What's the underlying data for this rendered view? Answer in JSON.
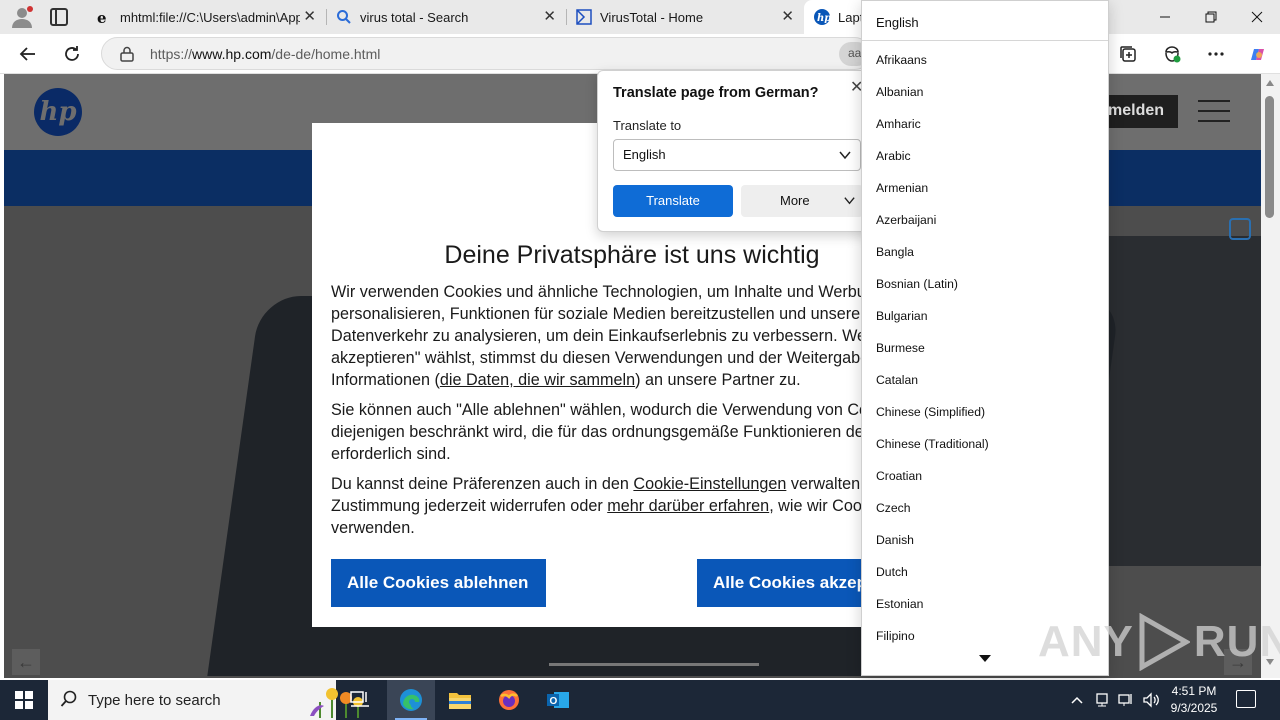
{
  "browser": {
    "tabs": [
      {
        "title": "mhtml:file://C:\\Users\\admin\\AppD",
        "close": "✕"
      },
      {
        "title": "virus total - Search",
        "close": "✕"
      },
      {
        "title": "VirusTotal - Home",
        "close": "✕"
      },
      {
        "title": "Lapt",
        "close": ""
      }
    ],
    "address": {
      "url_prefix": "https://",
      "url_domain": "www.hp.com",
      "url_path": "/de-de/home.html",
      "translate_chip": "aa"
    }
  },
  "page": {
    "hp_login_label": "melden",
    "hp_logo_text": "hp"
  },
  "cookie_dialog": {
    "title": "Deine Privatsphäre ist uns wichtig",
    "para1": {
      "line1": "Wir verwenden Cookies und ähnliche Technologien, um Inhalte und Werbun",
      "line2": "personalisieren, Funktionen für soziale Medien bereitzustellen und unserer",
      "line3": "Datenverkehr zu analysieren, um dein Einkaufserlebnis zu verbessern. Wen",
      "line4": "akzeptieren\" wählst, stimmst du diesen Verwendungen und der Weitergabe",
      "line5_before": "Informationen (",
      "line5_link": "die Daten, die wir sammeln",
      "line5_after": ") an unsere Partner zu."
    },
    "para2": {
      "line1": "Sie können auch \"Alle ablehnen\" wählen, wodurch die Verwendung von Coo",
      "line2": "diejenigen beschränkt wird, die für das ordnungsgemäße Funktionieren der",
      "line3": "erforderlich sind."
    },
    "para3": {
      "line1_before": "Du kannst deine Präferenzen auch in den ",
      "line1_link": "Cookie-Einstellungen",
      "line1_after": " verwalten, d",
      "line2_before": "Zustimmung jederzeit widerrufen oder ",
      "line2_link": "mehr darüber erfahren",
      "line2_after": ", wie wir Cook",
      "line3": "verwenden."
    },
    "reject_label": "Alle Cookies ablehnen",
    "accept_label": "Alle Cookies akzeptieren"
  },
  "translate_popup": {
    "title": "Translate page from German?",
    "translate_to_label": "Translate to",
    "selected_language": "English",
    "translate_button": "Translate",
    "more_button": "More",
    "close": "✕"
  },
  "language_dropdown": {
    "selected": "English",
    "items": [
      "Afrikaans",
      "Albanian",
      "Amharic",
      "Arabic",
      "Armenian",
      "Azerbaijani",
      "Bangla",
      "Bosnian (Latin)",
      "Bulgarian",
      "Burmese",
      "Catalan",
      "Chinese (Simplified)",
      "Chinese (Traditional)",
      "Croatian",
      "Czech",
      "Danish",
      "Dutch",
      "Estonian",
      "Filipino"
    ]
  },
  "watermark": {
    "left": "ANY",
    "right": "RUN"
  },
  "taskbar": {
    "search_placeholder": "Type here to search",
    "time": "4:51 PM",
    "date": "9/3/2025"
  },
  "colors": {
    "accent_blue": "#0f6cd6",
    "hp_blue": "#0a57b8",
    "taskbar": "#1c2737"
  }
}
